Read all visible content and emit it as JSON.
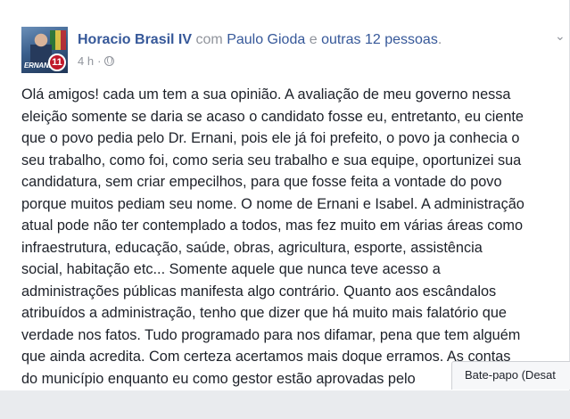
{
  "post": {
    "author": "Horacio Brasil IV",
    "with_word": "com",
    "tagged": "Paulo Gioda",
    "and_word": "e",
    "others": "outras 12 pessoas",
    "period": ".",
    "time": "4 h",
    "time_separator": "·",
    "privacy_icon": "globe-icon",
    "options_icon": "chevron-down-icon",
    "avatar_caption": "ERNANI",
    "avatar_number": "11",
    "text": "Olá amigos! cada um tem a sua opinião. A avaliação de meu governo nessa\neleição somente se daria se acaso o candidato fosse eu, entretanto, eu ciente\nque o povo pedia pelo Dr. Ernani, pois ele já foi prefeito, o povo ja conhecia o\nseu trabalho, como foi, como seria seu trabalho e sua equipe, oportunizei sua\ncandidatura, sem criar empecilhos, para que fosse feita a vontade do povo\nporque muitos pediam seu nome. O nome de Ernani e Isabel. A administração\natual pode não ter contemplado a todos, mas fez muito em várias áreas como\ninfraestrutura, educação, saúde, obras, agricultura, esporte, assistência\nsocial, habitação etc... Somente aquele que nunca teve acesso a\nadministrações públicas manifesta algo contrário. Quanto aos escândalos\natribuídos a administração, tenho que dizer que há muito mais falatório que\nverdade nos fatos. Tudo programado para nos difamar, pena que tem alguém\nque ainda acredita. Com certeza acertamos mais doque erramos. As contas\ndo município enquanto eu como gestor estão aprovadas pelo"
  },
  "chat": {
    "label": "Bate-papo (Desat"
  }
}
